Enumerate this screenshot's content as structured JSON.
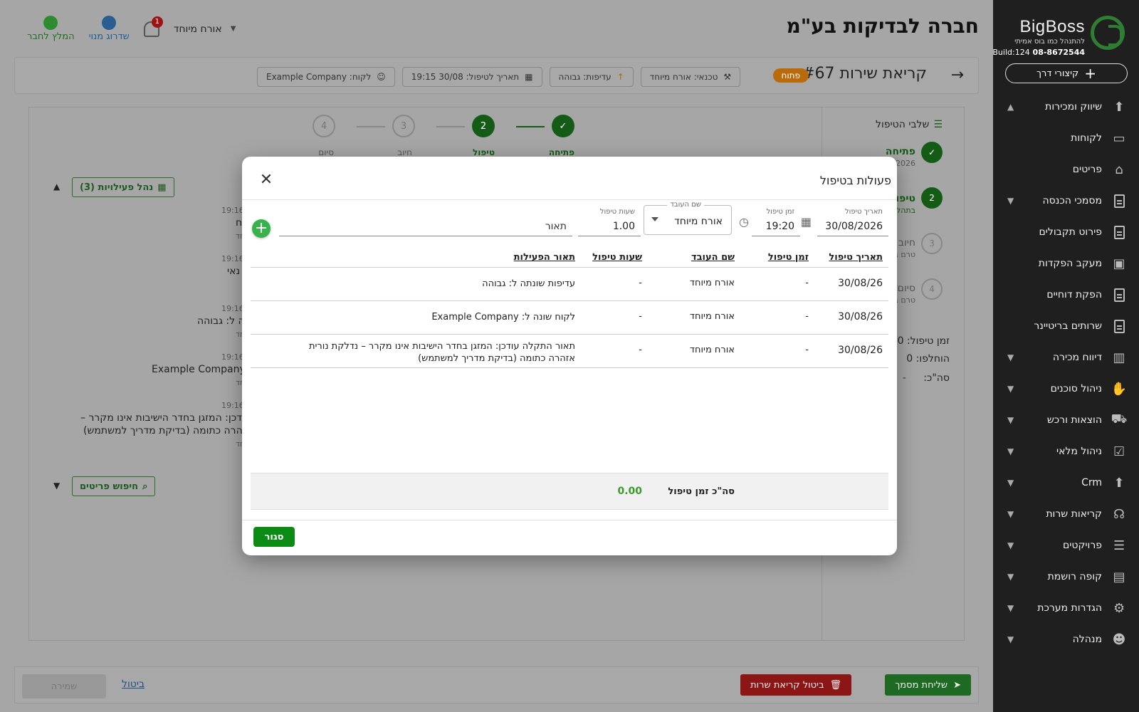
{
  "sidebar": {
    "logo_text": "BigBoss",
    "logo_tagline": "להתנהל כמו בוס אמיתי",
    "logo_phone": "08-8672544",
    "logo_build": "Build:124",
    "shortcut_label": "קיצורי דרך",
    "items": [
      {
        "label": "שיווק ומכירות",
        "icon": "shop-upload-icon",
        "chevron": "up"
      },
      {
        "label": "לקוחות",
        "icon": "contact-card-icon",
        "chevron": ""
      },
      {
        "label": "פריטים",
        "icon": "store-icon",
        "chevron": ""
      },
      {
        "label": "מסמכי הכנסה",
        "icon": "document-icon",
        "chevron": "down"
      },
      {
        "label": "פירוט תקבולים",
        "icon": "document-icon",
        "chevron": ""
      },
      {
        "label": "מעקב הפקדות",
        "icon": "cash-icon",
        "chevron": ""
      },
      {
        "label": "הפקת דוחיים",
        "icon": "document-icon",
        "chevron": ""
      },
      {
        "label": "שרותים בריטיינר",
        "icon": "document-icon",
        "chevron": ""
      },
      {
        "label": "דיווח מכירה",
        "icon": "bar-chart-icon",
        "chevron": "down"
      },
      {
        "label": "ניהול סוכנים",
        "icon": "handshake-icon",
        "chevron": "down"
      },
      {
        "label": "הוצאות ורכש",
        "icon": "cart-icon",
        "chevron": "down"
      },
      {
        "label": "ניהול מלאי",
        "icon": "clipboard-check-icon",
        "chevron": "down"
      },
      {
        "label": "Crm",
        "icon": "shop-upload-icon",
        "chevron": "down"
      },
      {
        "label": "קריאות שרות",
        "icon": "headset-icon",
        "chevron": "down"
      },
      {
        "label": "פרויקטים",
        "icon": "list-icon",
        "chevron": "down"
      },
      {
        "label": "קופה רושמת",
        "icon": "cash-register-icon",
        "chevron": "down"
      },
      {
        "label": "הגדרות מערכת",
        "icon": "gear-icon",
        "chevron": "down"
      },
      {
        "label": "מנהלה",
        "icon": "users-admin-icon",
        "chevron": "down"
      }
    ]
  },
  "header": {
    "company": "חברה לבדיקות בע\"מ",
    "whatsapp_label": "המלץ לחבר",
    "upgrade_label": "שדרוג מנוי",
    "notifications_count": "1",
    "user_name": "אורח מיוחד"
  },
  "call": {
    "title": "קריאת שירות #67",
    "status": "פתוח",
    "chips": [
      {
        "label": "לקוח: Example Company",
        "icon": "person-icon"
      },
      {
        "label": "תאריך לטיפול: 30/08 19:15",
        "icon": "calendar-icon"
      },
      {
        "label": "עדיפות: גבוהה",
        "icon": "arrow-up-icon"
      },
      {
        "label": "טכנאי: אורח מיוחד",
        "icon": "technician-icon"
      }
    ]
  },
  "steps": {
    "title": "שלבי הטיפול",
    "vertical": [
      {
        "label": "פתיחה",
        "sub": "2026",
        "state": "done",
        "num": "✓"
      },
      {
        "label": "טיפול",
        "sub": "בתהל",
        "state": "active",
        "num": "2"
      },
      {
        "label": "חיוב",
        "sub": "טרם ב",
        "state": "pending",
        "num": "3"
      },
      {
        "label": "סיום",
        "sub": "טרם ב",
        "state": "pending",
        "num": "4"
      }
    ],
    "horizontal": [
      {
        "label": "פתיחה",
        "num": "✓",
        "state": "done"
      },
      {
        "label": "טיפול",
        "num": "2",
        "state": "done"
      },
      {
        "label": "חיוב",
        "num": "3",
        "state": "pending"
      },
      {
        "label": "סיום",
        "num": "4",
        "state": "pending"
      }
    ],
    "summary": {
      "time_label": "זמן טיפול:",
      "time_val": "00",
      "replaced_label": "הוחלפו:",
      "replaced_val": "0",
      "total_label": "סה\"כ:",
      "total_val": "-"
    }
  },
  "activities_panel": {
    "manage_label": "נהל פעילויות (3)",
    "search_items_label": "חיפוש פריטים",
    "log": [
      {
        "time": "19:16",
        "text": "ח"
      },
      {
        "time": "19:16",
        "text": "נאי"
      },
      {
        "time": "19:16",
        "text": "ה ל: גבוהה"
      },
      {
        "time": "19:16",
        "text": "Example Company"
      },
      {
        "time": "19:16",
        "text": "עודכן: המזגן בחדר הישיבות אינו מקרר –",
        "text2": "אזהרה כתומה (בדיקת מדריך למשתמש)"
      }
    ],
    "log_by": "חד"
  },
  "footer": {
    "send_label": "שליחת מסמך",
    "cancel_call_label": "ביטול קריאת שרות",
    "cancel_label": "ביטול",
    "save_label": "שמירה"
  },
  "modal": {
    "title": "פעולות בטיפול",
    "form": {
      "date_label": "תאריך טיפול",
      "date_value": "30/08/2026",
      "time_label": "זמן טיפול",
      "time_value": "19:20",
      "worker_label": "שם העובד",
      "worker_value": "אורח מיוחד",
      "hours_label": "שעות טיפול",
      "hours_value": "1.00",
      "desc_placeholder": "תאור"
    },
    "columns": [
      "תאריך טיפול",
      "זמן טיפול",
      "שם העובד",
      "שעות טיפול",
      "תאור הפעילות"
    ],
    "rows": [
      {
        "date": "30/08/26",
        "time": "-",
        "worker": "אורח מיוחד",
        "hours": "-",
        "desc": "עדיפות שונתה ל: גבוהה"
      },
      {
        "date": "30/08/26",
        "time": "-",
        "worker": "אורח מיוחד",
        "hours": "-",
        "desc": "לקוח שונה ל: Example Company"
      },
      {
        "date": "30/08/26",
        "time": "-",
        "worker": "אורח מיוחד",
        "hours": "-",
        "desc": "תאור התקלה עודכן: המזגן בחדר הישיבות אינו מקרר – נדלקת נורית אזהרה כתומה (בדיקת מדריך למשתמש)"
      }
    ],
    "total_label": "סה\"כ זמן טיפול",
    "total_value": "0.00",
    "close_label": "סגור"
  }
}
